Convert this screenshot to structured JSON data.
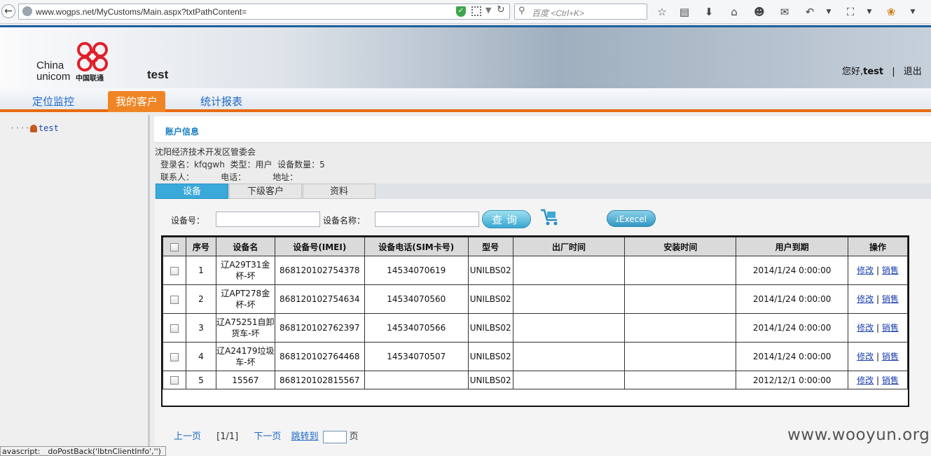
{
  "browser": {
    "url": "www.wogps.net/MyCustoms/Main.aspx?txtPathContent=",
    "search_placeholder": "百度 <Ctrl+K>"
  },
  "header": {
    "logo_line1": "China",
    "logo_line2": "unicom",
    "logo_cn": "中国联通",
    "username": "test",
    "greeting_prefix": "您好,",
    "greeting_user": "test",
    "logout": "退出"
  },
  "nav": {
    "tabs": [
      {
        "label": "定位监控",
        "active": false
      },
      {
        "label": "我的客户",
        "active": true
      },
      {
        "label": "统计报表",
        "active": false
      }
    ]
  },
  "sidebar": {
    "tree_node": "test"
  },
  "account": {
    "section_title": "账户信息",
    "org": "沈阳经济技术开发区管委会",
    "line1": "登录名：kfqgwh  类型：用户  设备数量：5",
    "line2": "联系人：          电话：          地址："
  },
  "subtabs": [
    {
      "label": "设备",
      "active": true
    },
    {
      "label": "下级客户",
      "active": false
    },
    {
      "label": "资料",
      "active": false
    }
  ],
  "filters": {
    "device_no_label": "设备号：",
    "device_name_label": "设备名称：",
    "query_label": "查询",
    "excel_label": "Execel"
  },
  "table": {
    "headers": [
      "序号",
      "设备名",
      "设备号(IMEI)",
      "设备电话(SIM卡号)",
      "型号",
      "出厂时间",
      "安装时间",
      "用户到期",
      "操作"
    ],
    "rows": [
      {
        "no": "1",
        "name": "辽A29T31金杯-坏",
        "imei": "868120102754378",
        "sim": "14534070619",
        "model": "UNILBS02",
        "factory": "",
        "install": "",
        "expire": "2014/1/24 0:00:00"
      },
      {
        "no": "2",
        "name": "辽APT278金杯-坏",
        "imei": "868120102754634",
        "sim": "14534070560",
        "model": "UNILBS02",
        "factory": "",
        "install": "",
        "expire": "2014/1/24 0:00:00"
      },
      {
        "no": "3",
        "name": "辽A75251自卸货车-坏",
        "imei": "868120102762397",
        "sim": "14534070566",
        "model": "UNILBS02",
        "factory": "",
        "install": "",
        "expire": "2014/1/24 0:00:00"
      },
      {
        "no": "4",
        "name": "辽A24179垃圾车-坏",
        "imei": "868120102764468",
        "sim": "14534070507",
        "model": "UNILBS02",
        "factory": "",
        "install": "",
        "expire": "2014/1/24 0:00:00"
      },
      {
        "no": "5",
        "name": "15567",
        "imei": "868120102815567",
        "sim": "",
        "model": "UNILBS02",
        "factory": "",
        "install": "",
        "expire": "2012/12/1 0:00:00"
      }
    ],
    "edit_label": "修改",
    "cancel_label": "销售",
    "sep": "|"
  },
  "pager": {
    "prev": "上一页",
    "current": "[1/1]",
    "next": "下一页",
    "jump": "跳转到",
    "page_unit": "页"
  },
  "watermark": "www.wooyun.org",
  "statusbar": "avascript:__doPostBack('lbtnClientInfo','')"
}
